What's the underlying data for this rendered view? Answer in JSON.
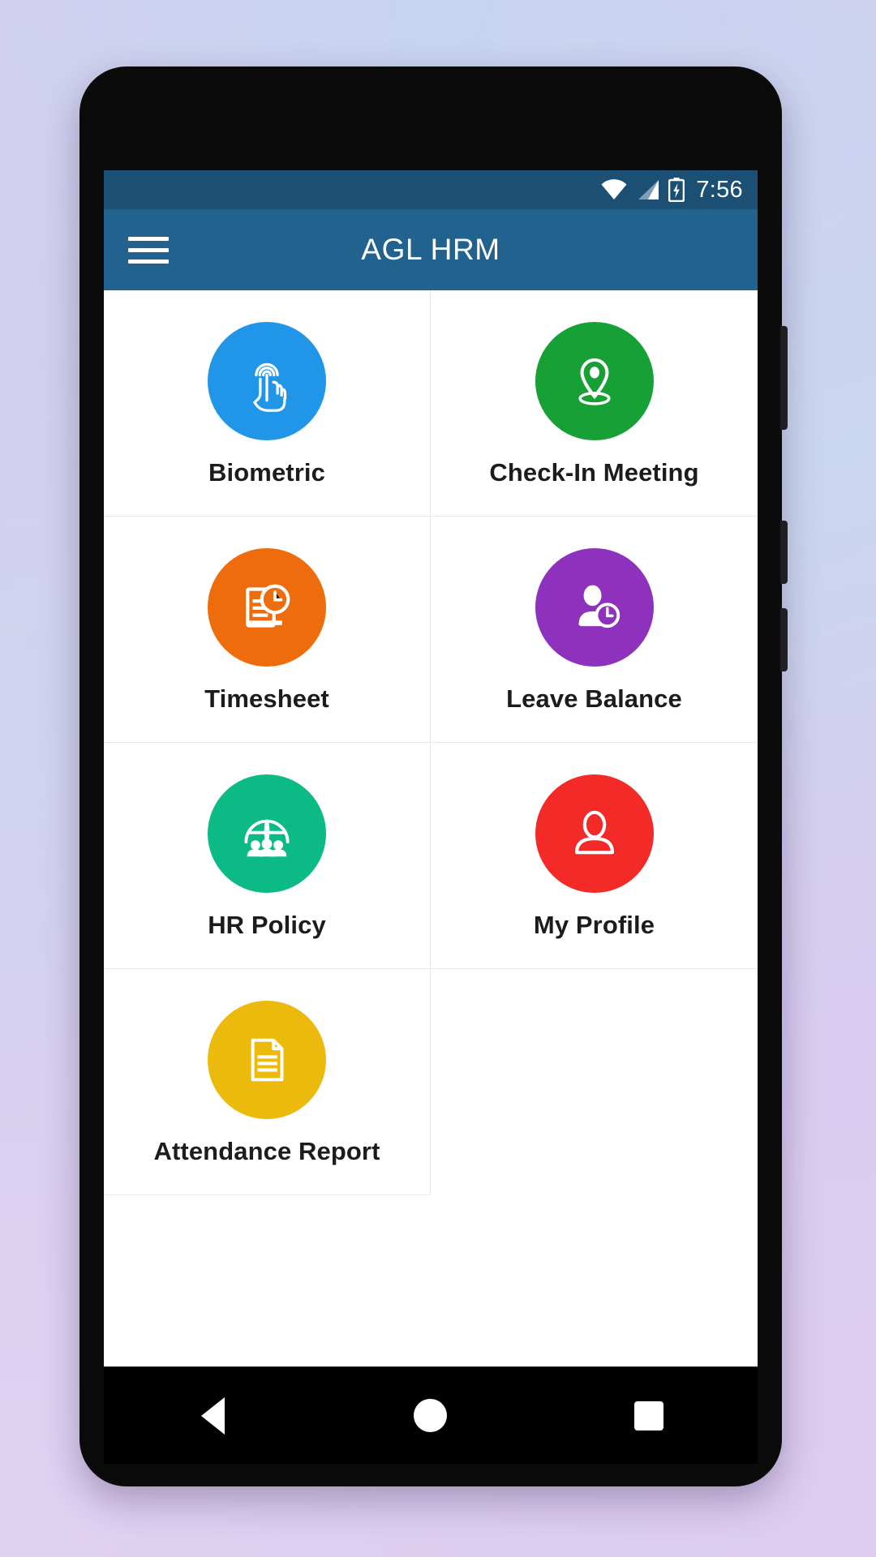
{
  "statusbar": {
    "time": "7:56",
    "wifi_icon": "wifi-icon",
    "signal_icon": "cellular-signal-icon",
    "battery_icon": "battery-charging-icon"
  },
  "toolbar": {
    "menu_icon": "hamburger-menu-icon",
    "title": "AGL HRM"
  },
  "grid": {
    "tiles": [
      {
        "label": "Biometric",
        "icon": "fingerprint-touch-icon",
        "color": "#2196e8"
      },
      {
        "label": "Check-In Meeting",
        "icon": "location-pin-icon",
        "color": "#17a036"
      },
      {
        "label": "Timesheet",
        "icon": "document-clock-icon",
        "color": "#ef6c0c"
      },
      {
        "label": "Leave Balance",
        "icon": "person-clock-icon",
        "color": "#8e32bd"
      },
      {
        "label": "HR Policy",
        "icon": "globe-people-icon",
        "color": "#0cba85"
      },
      {
        "label": "My Profile",
        "icon": "user-profile-icon",
        "color": "#f42a29"
      },
      {
        "label": "Attendance Report",
        "icon": "document-lines-icon",
        "color": "#ecb90d"
      }
    ]
  },
  "navbar": {
    "back_label": "Back",
    "home_label": "Home",
    "recents_label": "Recent apps"
  }
}
